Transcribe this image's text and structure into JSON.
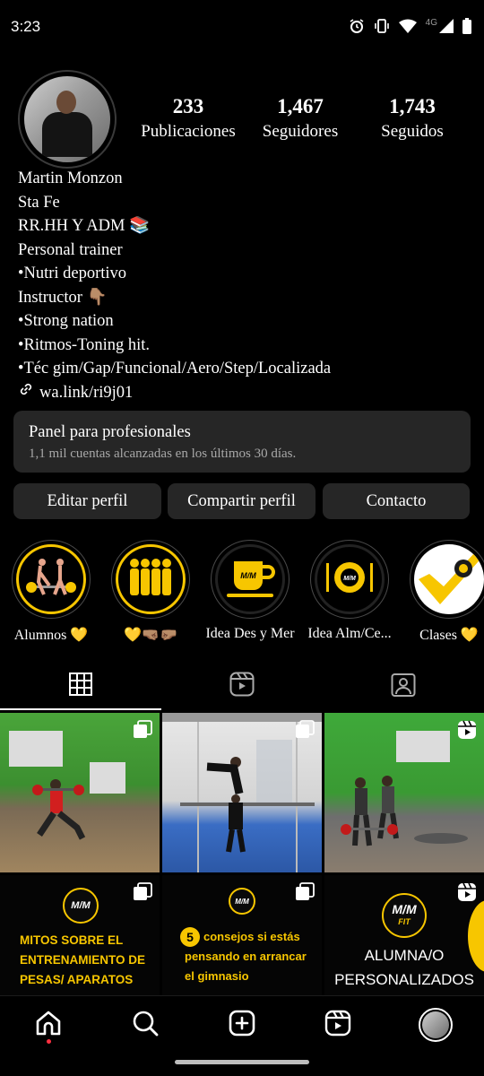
{
  "status_bar": {
    "time": "3:23",
    "network": "4G",
    "icons": [
      "alarm-icon",
      "vibrate-icon",
      "wifi-icon",
      "signal-icon",
      "battery-icon"
    ]
  },
  "profile": {
    "stats": [
      {
        "value": "233",
        "label": "Publicaciones"
      },
      {
        "value": "1,467",
        "label": "Seguidores"
      },
      {
        "value": "1,743",
        "label": "Seguidos"
      }
    ],
    "bio_lines": [
      "Martin Monzon",
      "Sta Fe",
      "RR.HH Y ADM 📚",
      "Personal trainer",
      "•Nutri deportivo",
      "Instructor 👇🏽",
      "•Strong nation",
      "•Ritmos-Toning hit.",
      "•Téc gim/Gap/Funcional/Aero/Step/Localizada"
    ],
    "link": "wa.link/ri9j01"
  },
  "panel": {
    "title": "Panel para profesionales",
    "subtitle": "1,1 mil cuentas alcanzadas en los últimos 30 días."
  },
  "buttons": {
    "edit": "Editar perfil",
    "share": "Compartir perfil",
    "contact": "Contacto"
  },
  "highlights": [
    {
      "label": "Alumnos 💛",
      "icon": "weightlifting-icon"
    },
    {
      "label": "💛🤜🏽🤛🏽",
      "icon": "group-icon"
    },
    {
      "label": "Idea Des y Mer",
      "icon": "coffee-cup-icon"
    },
    {
      "label": "Idea Alm/Ce...",
      "icon": "plate-cutlery-icon"
    },
    {
      "label": "Clases 💛",
      "icon": "checkmark-icon"
    }
  ],
  "tabs": [
    "grid-icon",
    "reels-icon",
    "tagged-icon"
  ],
  "posts": {
    "p4_lines": [
      "MITOS SOBRE EL",
      "ENTRENAMIENTO DE",
      "PESAS/ APARATOS"
    ],
    "p5_number": "5",
    "p5_lines": [
      "consejos si estás",
      "pensando en arrancar",
      "el gimnasio"
    ],
    "p6_lines": [
      "ALUMNA/O",
      "PERSONALIZADOS"
    ],
    "logo_text": "M/M",
    "logo_sub": "FIT"
  },
  "colors": {
    "accent": "#f7c600",
    "surface": "#262626",
    "notification": "#ff3040"
  },
  "bottom_nav": [
    "home-icon",
    "search-icon",
    "create-icon",
    "reels-icon",
    "profile-avatar"
  ]
}
